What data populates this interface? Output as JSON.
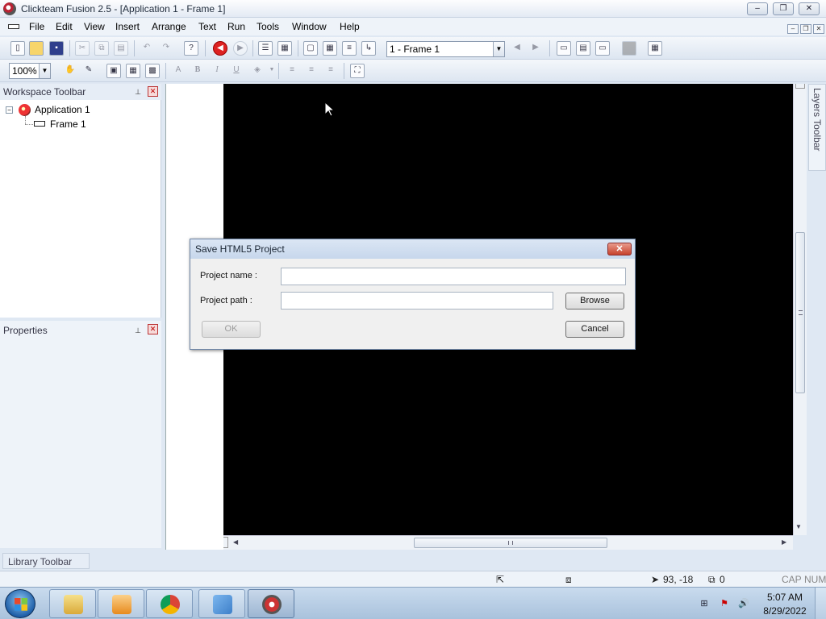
{
  "window": {
    "title": "Clickteam Fusion 2.5 - [Application 1 - Frame 1]",
    "minimize": "–",
    "restore": "❐",
    "close": "✕"
  },
  "menu": [
    "File",
    "Edit",
    "View",
    "Insert",
    "Arrange",
    "Text",
    "Run",
    "Tools",
    "Window",
    "Help"
  ],
  "toolbar": {
    "frame_select": "1 - Frame 1",
    "zoom": "100%",
    "bold": "B",
    "italic": "I",
    "underline": "U"
  },
  "workspace": {
    "title": "Workspace Toolbar",
    "tree": [
      {
        "label": "Application 1"
      },
      {
        "label": "Frame 1"
      }
    ]
  },
  "properties": {
    "title": "Properties"
  },
  "layers": {
    "title": "Layers Toolbar"
  },
  "library": {
    "title": "Library Toolbar"
  },
  "dialog": {
    "title": "Save HTML5 Project",
    "close": "✕",
    "project_name_label": "Project name :",
    "project_name_value": "",
    "project_path_label": "Project path :",
    "project_path_value": "",
    "browse": "Browse",
    "ok": "OK",
    "cancel": "Cancel"
  },
  "statusbar": {
    "coords": "93, -18",
    "count": "0",
    "caps": "CAP",
    "num": "NUM"
  },
  "taskbar": {
    "time": "5:07 AM",
    "date": "8/29/2022"
  },
  "colors": {
    "canvas": "#000000",
    "accent": "#1f5fa8"
  }
}
